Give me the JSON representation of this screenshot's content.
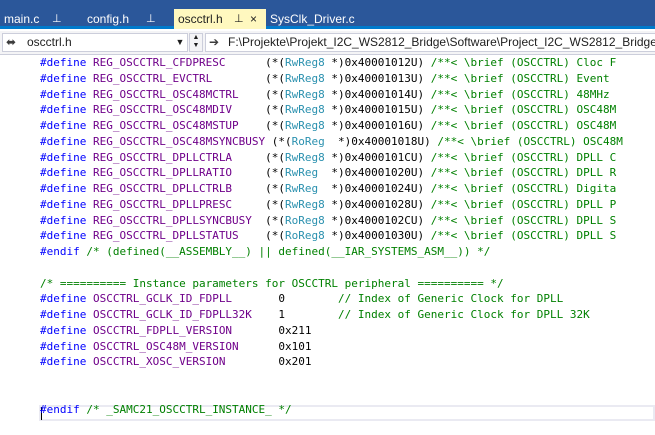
{
  "tabs": [
    {
      "label": "main.c",
      "pin": "⊥",
      "active": false
    },
    {
      "label": "config.h",
      "pin": "⊥",
      "active": false
    },
    {
      "label": "oscctrl.h",
      "pin": "⊥",
      "close": "×",
      "active": true
    },
    {
      "label": "SysClk_Driver.c",
      "active": false
    }
  ],
  "nav": {
    "file_label": "oscctrl.h",
    "file_icon": "h-file-icon",
    "path_label": "F:\\Projekte\\Projekt_I2C_WS2812_Bridge\\Software\\Project_I2C_WS2812_Bridge_At",
    "path_icon": "pin-arrow-icon"
  },
  "code_lines": [
    [
      [
        "kw",
        "#define "
      ],
      [
        "macro",
        "REG_OSCCTRL_CFDPRESC      "
      ],
      [
        "tx",
        "(*("
      ],
      [
        "type",
        "RwReg8"
      ],
      [
        "tx",
        " *)0x40001012U) "
      ],
      [
        "cm",
        "/**< \\brief (OSCCTRL) Cloc F"
      ]
    ],
    [
      [
        "kw",
        "#define "
      ],
      [
        "macro",
        "REG_OSCCTRL_EVCTRL        "
      ],
      [
        "tx",
        "(*("
      ],
      [
        "type",
        "RwReg8"
      ],
      [
        "tx",
        " *)0x40001013U) "
      ],
      [
        "cm",
        "/**< \\brief (OSCCTRL) Event "
      ]
    ],
    [
      [
        "kw",
        "#define "
      ],
      [
        "macro",
        "REG_OSCCTRL_OSC48MCTRL    "
      ],
      [
        "tx",
        "(*("
      ],
      [
        "type",
        "RwReg8"
      ],
      [
        "tx",
        " *)0x40001014U) "
      ],
      [
        "cm",
        "/**< \\brief (OSCCTRL) 48MHz "
      ]
    ],
    [
      [
        "kw",
        "#define "
      ],
      [
        "macro",
        "REG_OSCCTRL_OSC48MDIV     "
      ],
      [
        "tx",
        "(*("
      ],
      [
        "type",
        "RwReg8"
      ],
      [
        "tx",
        " *)0x40001015U) "
      ],
      [
        "cm",
        "/**< \\brief (OSCCTRL) OSC48M"
      ]
    ],
    [
      [
        "kw",
        "#define "
      ],
      [
        "macro",
        "REG_OSCCTRL_OSC48MSTUP    "
      ],
      [
        "tx",
        "(*("
      ],
      [
        "type",
        "RwReg8"
      ],
      [
        "tx",
        " *)0x40001016U) "
      ],
      [
        "cm",
        "/**< \\brief (OSCCTRL) OSC48M"
      ]
    ],
    [
      [
        "kw",
        "#define "
      ],
      [
        "macro",
        "REG_OSCCTRL_OSC48MSYNCBUSY "
      ],
      [
        "tx",
        "(*("
      ],
      [
        "type",
        "RoReg "
      ],
      [
        "tx",
        " *)0x40001018U) "
      ],
      [
        "cm",
        "/**< \\brief (OSCCTRL) OSC48M"
      ]
    ],
    [
      [
        "kw",
        "#define "
      ],
      [
        "macro",
        "REG_OSCCTRL_DPLLCTRLA     "
      ],
      [
        "tx",
        "(*("
      ],
      [
        "type",
        "RwReg8"
      ],
      [
        "tx",
        " *)0x4000101CU) "
      ],
      [
        "cm",
        "/**< \\brief (OSCCTRL) DPLL C"
      ]
    ],
    [
      [
        "kw",
        "#define "
      ],
      [
        "macro",
        "REG_OSCCTRL_DPLLRATIO     "
      ],
      [
        "tx",
        "(*("
      ],
      [
        "type",
        "RwReg "
      ],
      [
        "tx",
        " *)0x40001020U) "
      ],
      [
        "cm",
        "/**< \\brief (OSCCTRL) DPLL R"
      ]
    ],
    [
      [
        "kw",
        "#define "
      ],
      [
        "macro",
        "REG_OSCCTRL_DPLLCTRLB     "
      ],
      [
        "tx",
        "(*("
      ],
      [
        "type",
        "RwReg "
      ],
      [
        "tx",
        " *)0x40001024U) "
      ],
      [
        "cm",
        "/**< \\brief (OSCCTRL) Digita"
      ]
    ],
    [
      [
        "kw",
        "#define "
      ],
      [
        "macro",
        "REG_OSCCTRL_DPLLPRESC     "
      ],
      [
        "tx",
        "(*("
      ],
      [
        "type",
        "RwReg8"
      ],
      [
        "tx",
        " *)0x40001028U) "
      ],
      [
        "cm",
        "/**< \\brief (OSCCTRL) DPLL P"
      ]
    ],
    [
      [
        "kw",
        "#define "
      ],
      [
        "macro",
        "REG_OSCCTRL_DPLLSYNCBUSY  "
      ],
      [
        "tx",
        "(*("
      ],
      [
        "type",
        "RoReg8"
      ],
      [
        "tx",
        " *)0x4000102CU) "
      ],
      [
        "cm",
        "/**< \\brief (OSCCTRL) DPLL S"
      ]
    ],
    [
      [
        "kw",
        "#define "
      ],
      [
        "macro",
        "REG_OSCCTRL_DPLLSTATUS    "
      ],
      [
        "tx",
        "(*("
      ],
      [
        "type",
        "RoReg8"
      ],
      [
        "tx",
        " *)0x40001030U) "
      ],
      [
        "cm",
        "/**< \\brief (OSCCTRL) DPLL S"
      ]
    ],
    [
      [
        "kw",
        "#endif "
      ],
      [
        "cm",
        "/* (defined(__ASSEMBLY__) || defined(__IAR_SYSTEMS_ASM__)) */"
      ]
    ],
    [],
    [
      [
        "cm",
        "/* ========== Instance parameters for OSCCTRL peripheral ========== */"
      ]
    ],
    [
      [
        "kw",
        "#define "
      ],
      [
        "macro",
        "OSCCTRL_GCLK_ID_FDPLL       "
      ],
      [
        "num",
        "0        "
      ],
      [
        "cm",
        "// Index of Generic Clock for DPLL"
      ]
    ],
    [
      [
        "kw",
        "#define "
      ],
      [
        "macro",
        "OSCCTRL_GCLK_ID_FDPLL32K    "
      ],
      [
        "num",
        "1        "
      ],
      [
        "cm",
        "// Index of Generic Clock for DPLL 32K"
      ]
    ],
    [
      [
        "kw",
        "#define "
      ],
      [
        "macro",
        "OSCCTRL_FDPLL_VERSION       "
      ],
      [
        "num",
        "0x211"
      ]
    ],
    [
      [
        "kw",
        "#define "
      ],
      [
        "macro",
        "OSCCTRL_OSC48M_VERSION      "
      ],
      [
        "num",
        "0x101"
      ]
    ],
    [
      [
        "kw",
        "#define "
      ],
      [
        "macro",
        "OSCCTRL_XOSC_VERSION        "
      ],
      [
        "num",
        "0x201"
      ]
    ],
    [],
    [],
    [
      [
        "kw",
        "#endif "
      ],
      [
        "cm",
        "/* _SAMC21_OSCCTRL_INSTANCE_ */"
      ]
    ],
    []
  ]
}
